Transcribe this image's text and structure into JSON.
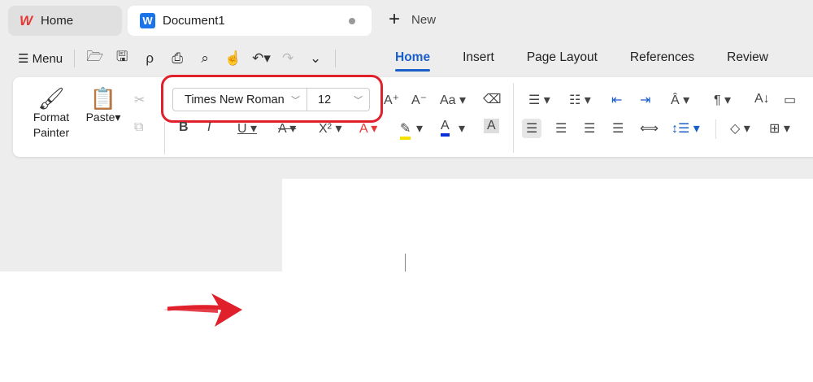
{
  "tabs": {
    "home": "Home",
    "document": "Document1",
    "new": "New"
  },
  "quickbar": {
    "menu": "Menu",
    "icons": [
      "open-icon",
      "save-icon",
      "export-pdf-icon",
      "print-icon",
      "print-preview-icon",
      "hand-icon",
      "undo-icon",
      "redo-icon",
      "more-icon"
    ]
  },
  "ribbon_tabs": [
    "Home",
    "Insert",
    "Page Layout",
    "References",
    "Review"
  ],
  "ribbon": {
    "format_painter": [
      "Format",
      "Painter"
    ],
    "paste": "Paste",
    "font_name": "Times New Roman",
    "font_size": "12"
  },
  "colors": {
    "accent": "#1a5fc8",
    "highlight_box": "#e0202a",
    "highlight_color": "#f5e100",
    "font_color": "#0a2fd6"
  }
}
